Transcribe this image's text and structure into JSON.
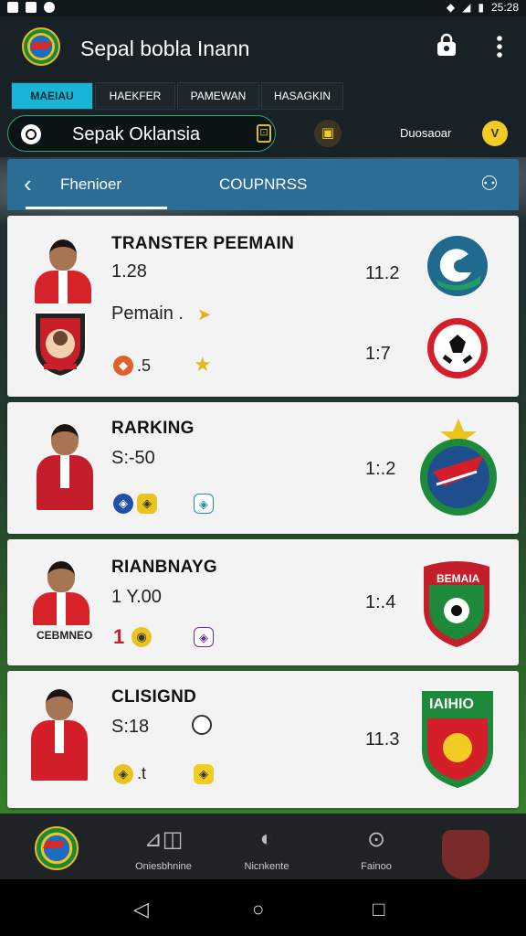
{
  "status_bar": {
    "time": "25:28"
  },
  "app_bar": {
    "title": "Sepal bobla Inann"
  },
  "tabs": [
    {
      "label": "MAEIAU",
      "active": true
    },
    {
      "label": "HAEKFER",
      "active": false
    },
    {
      "label": "PAMEWAN",
      "active": false
    },
    {
      "label": "HASAGKIN",
      "active": false
    }
  ],
  "search": {
    "value": "Sepak Oklansia",
    "discover_label": "Duosaoar"
  },
  "subnav": {
    "left_label": "Fhenioer",
    "center_label": "COUPNRSS"
  },
  "cards": [
    {
      "title": "TRANSTER PEEMAIN",
      "value": "1.28",
      "score_top": "11.2",
      "sub_label": "Pemain .",
      "score_bottom": "1:7",
      "icon_text": ".5"
    },
    {
      "title": "RARKING",
      "value": "S:-50",
      "score": "1:.2"
    },
    {
      "title": "RIANBNAYG",
      "value": "1 Y.00",
      "score": "1:.4",
      "player_label": "CEBMNEO",
      "highlight_num": "1",
      "crest_text": "BEMAIA"
    },
    {
      "title": "CLISIGND",
      "value": "S:18",
      "score": "11.3",
      "icon_text": ".t",
      "crest_text": "IAIHIO"
    }
  ],
  "bottom_nav": [
    {
      "label": ""
    },
    {
      "label": "Oniesbhnine"
    },
    {
      "label": "Nicnkente"
    },
    {
      "label": "Fainoo"
    },
    {
      "label": ""
    }
  ],
  "colors": {
    "accent": "#17b5d6",
    "subnav": "#2b6d94",
    "card": "#f3f3f3",
    "gold": "#f2cc25"
  }
}
